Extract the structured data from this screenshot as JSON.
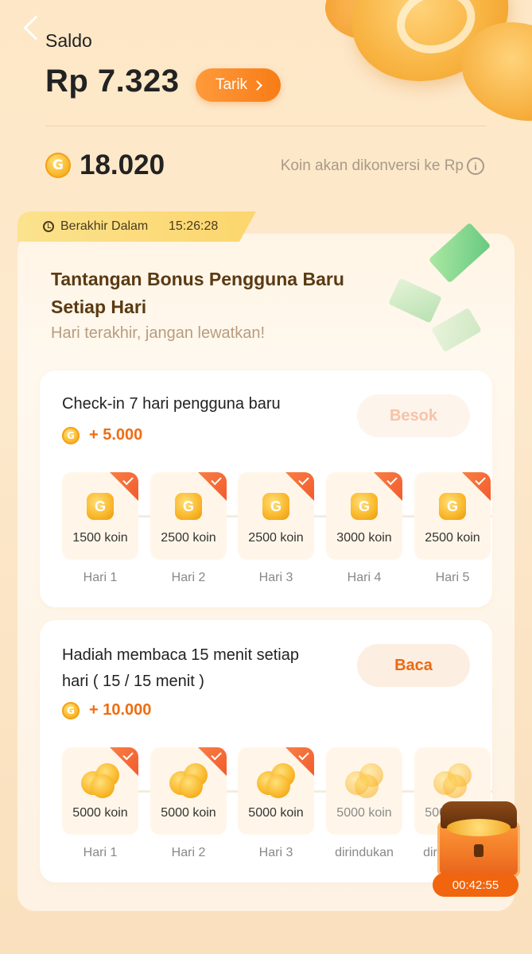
{
  "header": {
    "title": "Saldo",
    "balance": "Rp 7.323",
    "withdraw_label": "Tarik",
    "coins": "18.020",
    "convert_note": "Koin akan dikonversi ke Rp"
  },
  "challenge": {
    "timer_label": "Berakhir Dalam",
    "timer_value": "15:26:28",
    "title": "Tantangan Bonus Pengguna Baru Setiap Hari",
    "subtitle": "Hari terakhir, jangan lewatkan!"
  },
  "checkin": {
    "title": "Check-in 7 hari pengguna baru",
    "reward": "+ 5.000",
    "button": "Besok",
    "days": [
      {
        "amount": "1500 koin",
        "label": "Hari 1",
        "done": true
      },
      {
        "amount": "2500 koin",
        "label": "Hari 2",
        "done": true
      },
      {
        "amount": "2500 koin",
        "label": "Hari 3",
        "done": true
      },
      {
        "amount": "3000 koin",
        "label": "Hari 4",
        "done": true
      },
      {
        "amount": "2500 koin",
        "label": "Hari 5",
        "done": true
      }
    ]
  },
  "reading": {
    "title_line1": "Hadiah membaca 15 menit setiap",
    "title_line2": "hari ( 15  / 15  menit )",
    "reward": "+ 10.000",
    "button": "Baca",
    "days": [
      {
        "amount": "5000 koin",
        "label": "Hari 1",
        "done": true
      },
      {
        "amount": "5000 koin",
        "label": "Hari 2",
        "done": true
      },
      {
        "amount": "5000 koin",
        "label": "Hari 3",
        "done": true
      },
      {
        "amount": "5000 koin",
        "label": "dirindukan",
        "done": false
      },
      {
        "amount": "5000 koin",
        "label": "dirindukan",
        "done": false
      }
    ]
  },
  "chest": {
    "timer": "00:42:55"
  },
  "colors": {
    "accent": "#f77c16",
    "reward": "#ef6d12",
    "check": "#f25b2d"
  }
}
